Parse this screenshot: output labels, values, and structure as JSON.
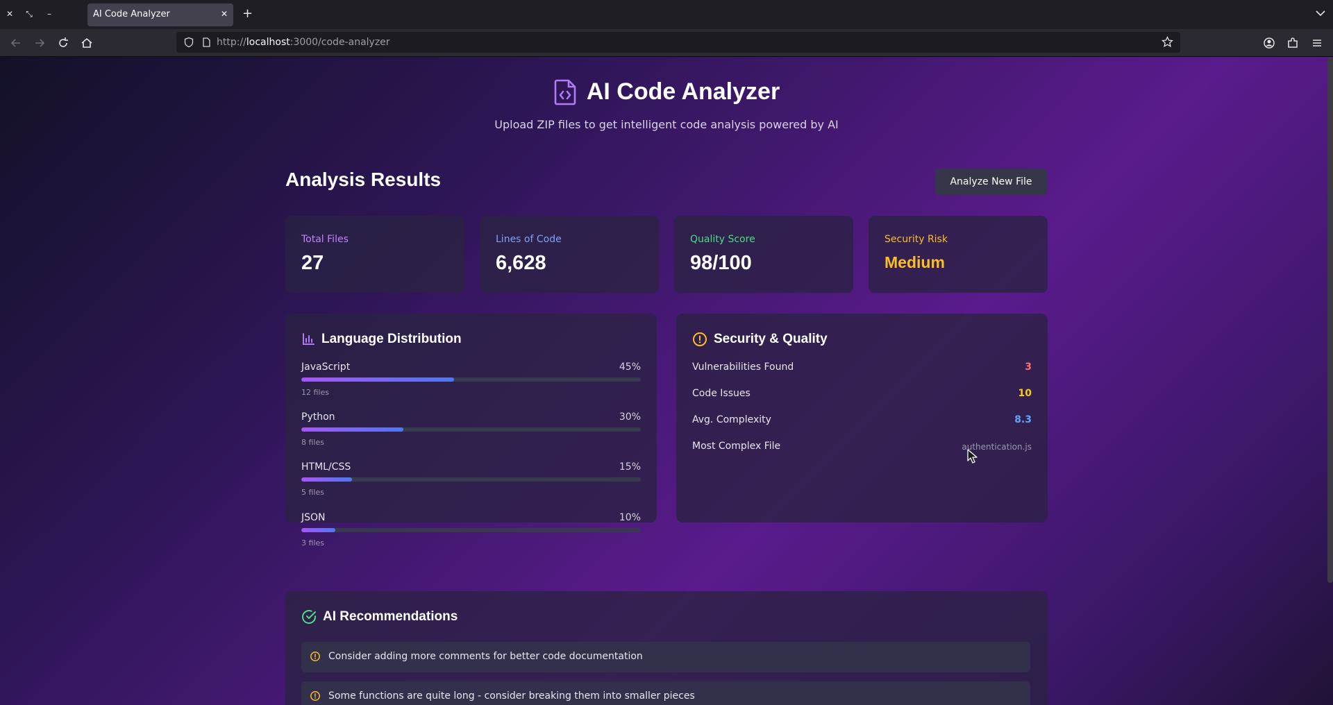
{
  "browser": {
    "tab_title": "AI Code Analyzer",
    "url_prefix": "http://",
    "url_host": "localhost",
    "url_path": ":3000/code-analyzer"
  },
  "header": {
    "title": "AI Code Analyzer",
    "subtitle": "Upload ZIP files to get intelligent code analysis powered by AI"
  },
  "results": {
    "title": "Analysis Results",
    "analyze_button": "Analyze New File"
  },
  "stats": [
    {
      "label": "Total Files",
      "value": "27",
      "color": "#c084fc"
    },
    {
      "label": "Lines of Code",
      "value": "6,628",
      "color": "#7ea2f5"
    },
    {
      "label": "Quality Score",
      "value": "98/100",
      "color": "#4ade80"
    },
    {
      "label": "Security Risk",
      "value": "Medium",
      "color": "#fbbf24"
    }
  ],
  "languages": {
    "title": "Language Distribution",
    "items": [
      {
        "name": "JavaScript",
        "percent": "45%",
        "fraction": 0.45,
        "files": "12 files"
      },
      {
        "name": "Python",
        "percent": "30%",
        "fraction": 0.3,
        "files": "8 files"
      },
      {
        "name": "HTML/CSS",
        "percent": "15%",
        "fraction": 0.15,
        "files": "5 files"
      },
      {
        "name": "JSON",
        "percent": "10%",
        "fraction": 0.1,
        "files": "3 files"
      }
    ]
  },
  "security": {
    "title": "Security & Quality",
    "rows": [
      {
        "label": "Vulnerabilities Found",
        "value": "3",
        "color": "#f87171"
      },
      {
        "label": "Code Issues",
        "value": "10",
        "color": "#facc15"
      },
      {
        "label": "Avg. Complexity",
        "value": "8.3",
        "color": "#60a5fa"
      },
      {
        "label": "Most Complex File",
        "value": "authentication.js",
        "color": "#9b97ad"
      }
    ]
  },
  "recommendations": {
    "title": "AI Recommendations",
    "items": [
      "Consider adding more comments for better code documentation",
      "Some functions are quite long - consider breaking them into smaller pieces"
    ]
  }
}
